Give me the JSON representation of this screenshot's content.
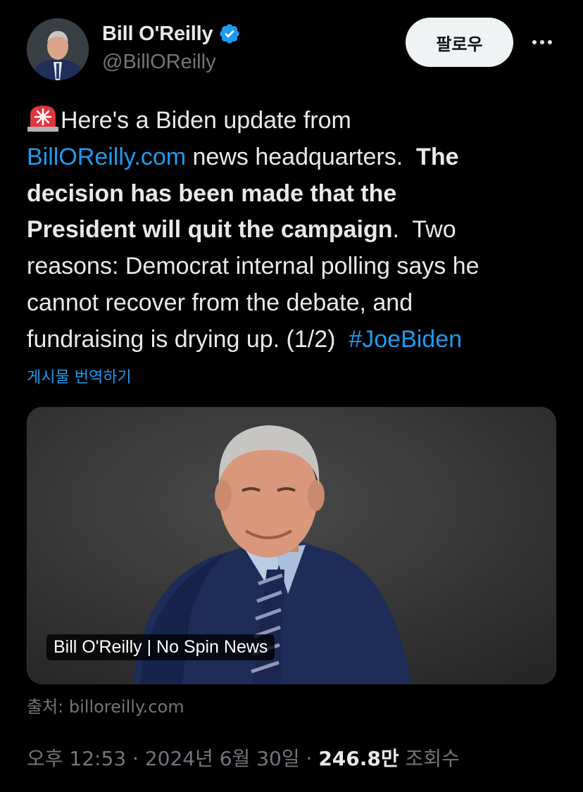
{
  "author": {
    "name": "Bill O'Reilly",
    "handle": "@BillOReilly",
    "verified": true,
    "verified_color": "#1d9bf0"
  },
  "actions": {
    "follow_label": "팔로우",
    "more_icon": "more-horizontal-icon"
  },
  "tweet": {
    "emoji_icon": "siren-icon",
    "line1": "Here's a Biden update from",
    "link_text": "BillOReilly.com",
    "line2_after_link": " news headquarters.  ",
    "line2_bold": "The",
    "line3_bold": "decision has been made that the",
    "line4_bold": "President will quit the campaign",
    "line4_after": ".  Two",
    "line5": "reasons: Democrat internal polling says he",
    "line6": "cannot recover from the debate, and",
    "line7": "fundraising is drying up. (1/2)  ",
    "hashtag": "#JoeBiden",
    "link_color": "#1d9bf0"
  },
  "translate_label": "게시물 번역하기",
  "media": {
    "caption": "Bill O'Reilly | No Spin News"
  },
  "source_label": "출처: billoreilly.com",
  "meta": {
    "time": "오후 12:53",
    "separator": " · ",
    "date": "2024년 6월 30일",
    "views_count": "246.8만",
    "views_label": " 조회수"
  }
}
